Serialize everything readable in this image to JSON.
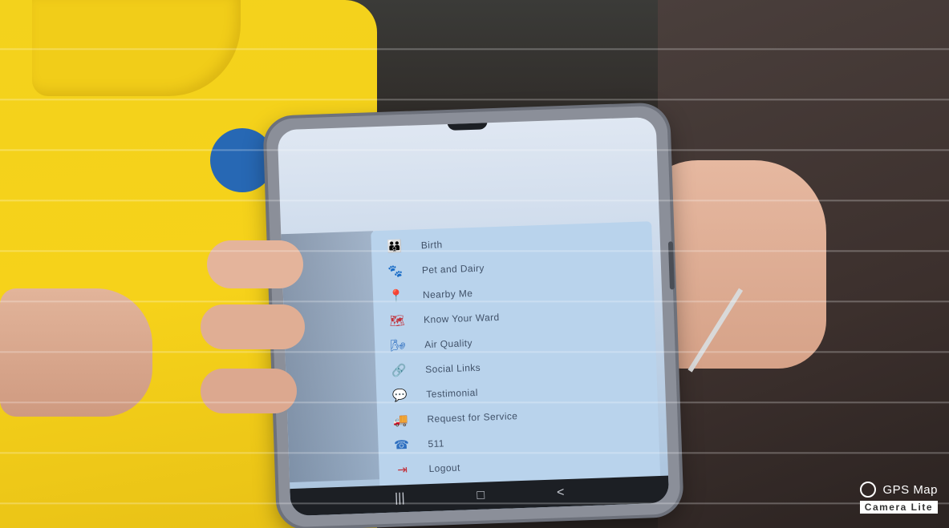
{
  "menu": {
    "items": [
      {
        "label": "Birth",
        "icon": "family-icon",
        "color": "#3a6fb8"
      },
      {
        "label": "Pet and Dairy",
        "icon": "pet-icon",
        "color": "#d8a21e"
      },
      {
        "label": "Nearby Me",
        "icon": "location-pin-icon",
        "color": "#c2303a"
      },
      {
        "label": "Know Your Ward",
        "icon": "map-icon",
        "color": "#c2303a"
      },
      {
        "label": "Air Quality",
        "icon": "air-icon",
        "color": "#2e6fc0"
      },
      {
        "label": "Social Links",
        "icon": "share-icon",
        "color": "#2e6fc0"
      },
      {
        "label": "Testimonial",
        "icon": "testimonial-icon",
        "color": "#2e6fc0"
      },
      {
        "label": "Request for Service",
        "icon": "truck-icon",
        "color": "#2f8a3c"
      },
      {
        "label": "511",
        "icon": "phone-icon",
        "color": "#2e6fc0"
      },
      {
        "label": "Logout",
        "icon": "logout-icon",
        "color": "#c2303a"
      }
    ]
  },
  "navbar": {
    "recent": "|||",
    "home": "□",
    "back": "<"
  },
  "watermark": {
    "line1": "GPS Map",
    "line2": "Camera Lite"
  }
}
